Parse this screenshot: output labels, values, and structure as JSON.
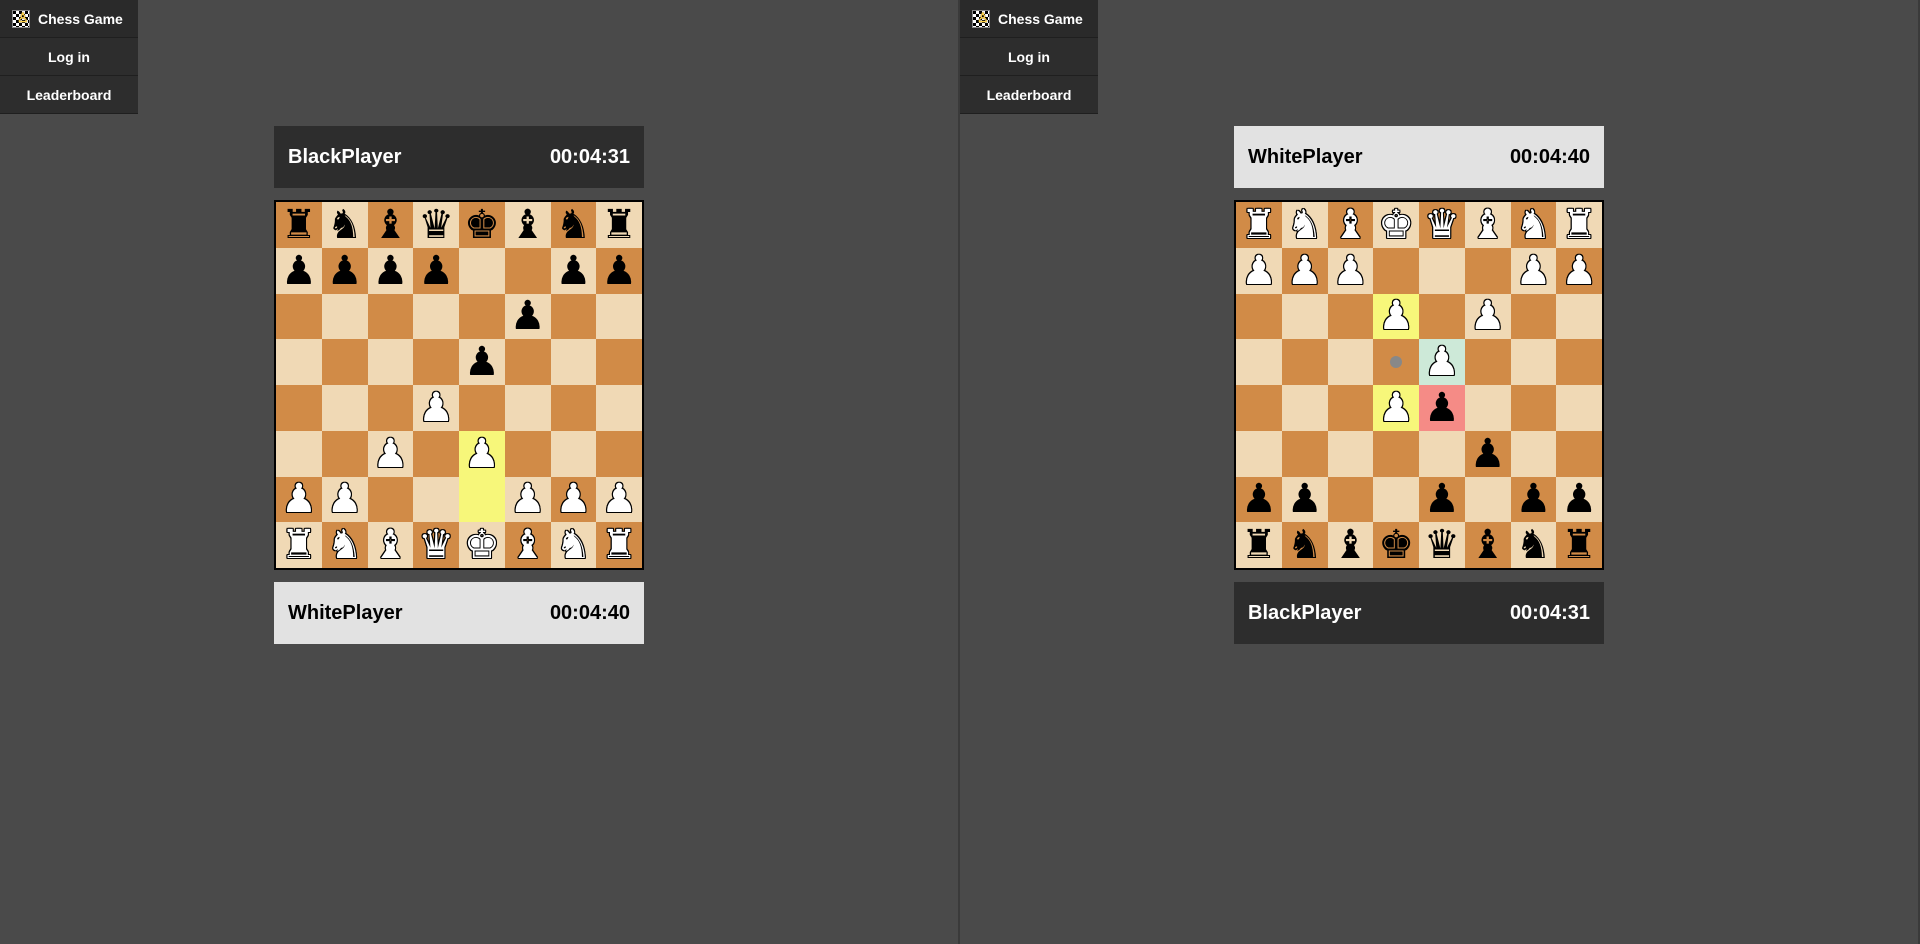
{
  "sidebar": {
    "brand": "Chess Game",
    "login": "Log in",
    "leaderboard": "Leaderboard"
  },
  "players": {
    "white": {
      "name": "WhitePlayer",
      "clock": "00:04:40"
    },
    "black": {
      "name": "BlackPlayer",
      "clock": "00:04:31"
    }
  },
  "glyph": {
    "K": "♚",
    "Q": "♛",
    "R": "♜",
    "B": "♝",
    "N": "♞",
    "P": "♟"
  },
  "boards": {
    "left": {
      "orientation": "white",
      "top": "black",
      "bottom": "white",
      "pieces": {
        "a8": "bR",
        "b8": "bN",
        "c8": "bB",
        "d8": "bQ",
        "e8": "bK",
        "f8": "bB",
        "g8": "bN",
        "h8": "bR",
        "a7": "bP",
        "b7": "bP",
        "c7": "bP",
        "d7": "bP",
        "g7": "bP",
        "h7": "bP",
        "f6": "bP",
        "e5": "bP",
        "d4": "wP",
        "c3": "wP",
        "e3": "wP",
        "a2": "wP",
        "b2": "wP",
        "f2": "wP",
        "g2": "wP",
        "h2": "wP",
        "a1": "wR",
        "b1": "wN",
        "c1": "wB",
        "d1": "wQ",
        "e1": "wK",
        "f1": "wB",
        "g1": "wN",
        "h1": "wR"
      },
      "highlights": {
        "e2": "from",
        "e3": "to"
      }
    },
    "right": {
      "orientation": "black",
      "top": "white",
      "bottom": "black",
      "pieces": {
        "a8": "bR",
        "b8": "bN",
        "c8": "bB",
        "d8": "bQ",
        "e8": "bK",
        "f8": "bB",
        "g8": "bN",
        "h8": "bR",
        "a7": "bP",
        "b7": "bP",
        "d7": "bP",
        "g7": "bP",
        "h7": "bP",
        "c6": "bP",
        "d4": "wP",
        "d5": "bP",
        "e5": "wP",
        "c3": "wP",
        "e3": "wP",
        "a2": "wP",
        "b2": "wP",
        "f2": "wP",
        "g2": "wP",
        "h2": "wP",
        "a1": "wR",
        "b1": "wN",
        "c1": "wB",
        "d1": "wQ",
        "e1": "wK",
        "f1": "wB",
        "g1": "wN",
        "h1": "wR"
      },
      "highlights": {
        "e3": "from",
        "e5": "to",
        "d4": "sel",
        "d5": "cap"
      },
      "moveDots": [
        "e4"
      ]
    }
  }
}
